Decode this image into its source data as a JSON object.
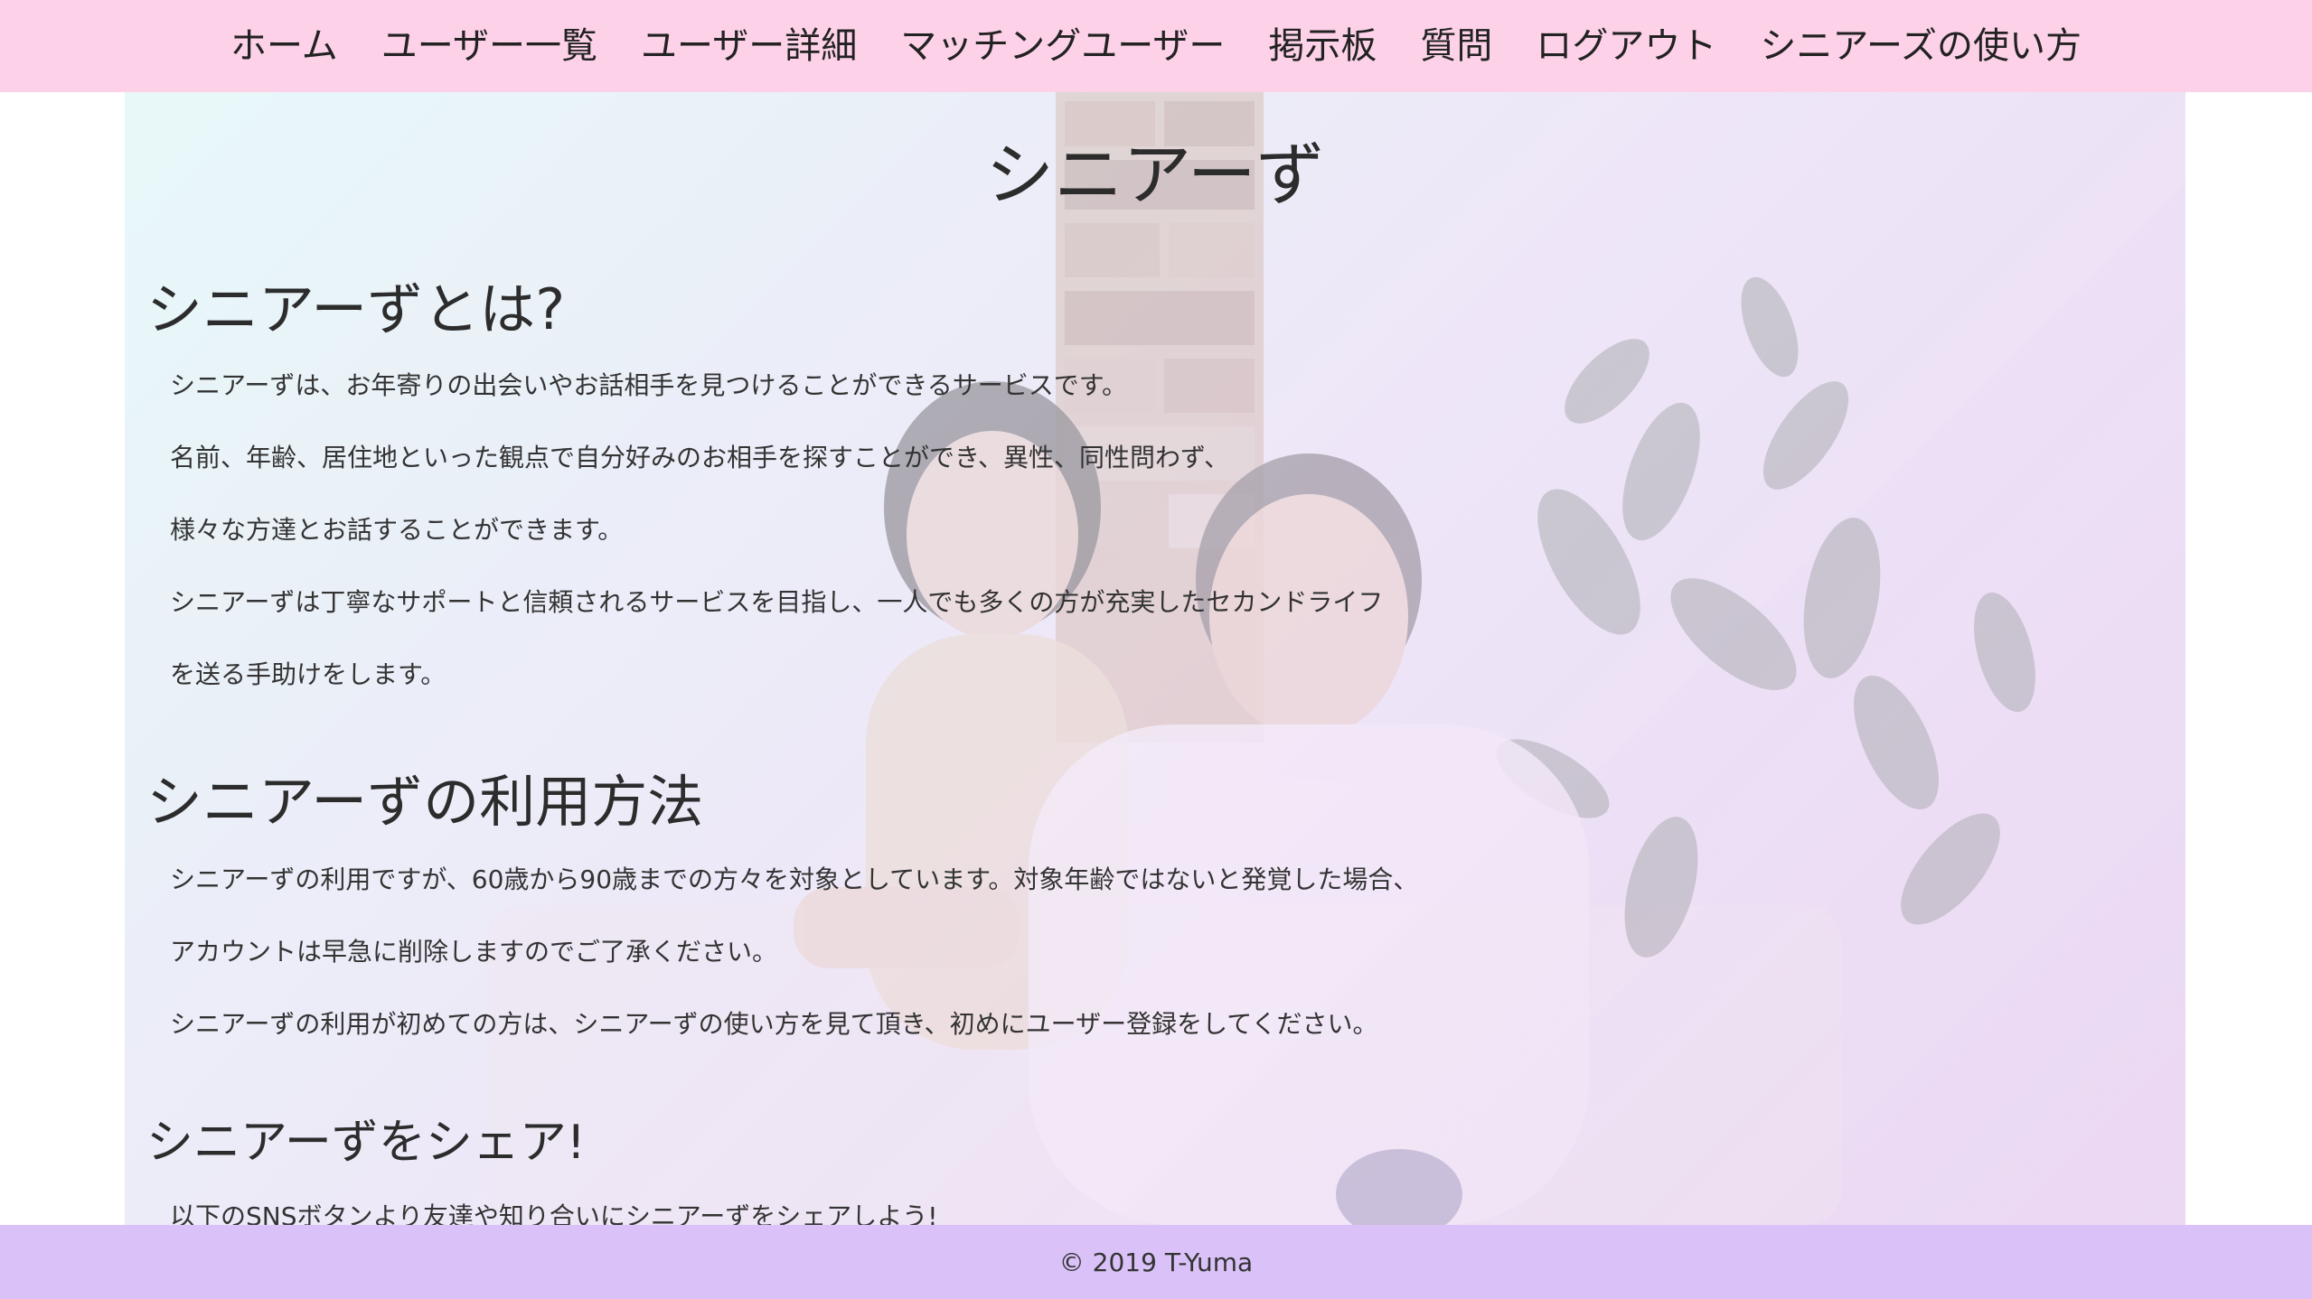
{
  "nav": {
    "items": [
      {
        "label": "ホーム"
      },
      {
        "label": "ユーザー一覧"
      },
      {
        "label": "ユーザー詳細"
      },
      {
        "label": "マッチングユーザー"
      },
      {
        "label": "掲示板"
      },
      {
        "label": "質問"
      },
      {
        "label": "ログアウト"
      },
      {
        "label": "シニアーズの使い方"
      }
    ]
  },
  "hero": {
    "title": "シニアーず",
    "background_image": "senior-couple-photo"
  },
  "about": {
    "heading": "シニアーずとは?",
    "lines": [
      "シニアーずは、お年寄りの出会いやお話相手を見つけることができるサービスです。",
      "名前、年齢、居住地といった観点で自分好みのお相手を探すことができ、異性、同性問わず、",
      "様々な方達とお話することができます。",
      "シニアーずは丁寧なサポートと信頼されるサービスを目指し、一人でも多くの方が充実したセカンドライフ",
      "を送る手助けをします。"
    ]
  },
  "usage": {
    "heading": "シニアーずの利用方法",
    "lines": [
      "シニアーずの利用ですが、60歳から90歳までの方々を対象としています。対象年齢ではないと発覚した場合、",
      "アカウントは早急に削除しますのでご了承ください。",
      "シニアーずの利用が初めての方は、シニアーずの使い方を見て頂き、初めにユーザー登録をしてください。"
    ]
  },
  "share": {
    "heading": "シニアーずをシェア!",
    "lines": [
      "以下のSNSボタンより友達や知り合いにシニアーずをシェアしよう!"
    ]
  },
  "footer": {
    "copyright": "© 2019 T-Yuma"
  },
  "colors": {
    "nav_bg": "#fdd2e8",
    "footer_bg": "#dac2f8",
    "text": "#333333"
  }
}
